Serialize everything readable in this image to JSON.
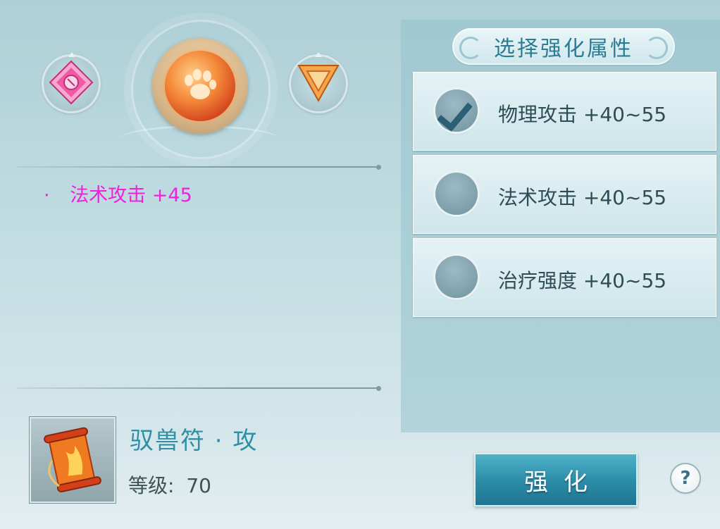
{
  "gems": {
    "left": {
      "icon": "pink-diamond-gem-icon",
      "color": "#e84a9c"
    },
    "center": {
      "icon": "orange-beast-claw-orb-icon",
      "color": "#f07a2e"
    },
    "right": {
      "icon": "orange-triangle-gem-icon",
      "color": "#f28a2a"
    }
  },
  "current_attribute": {
    "bullet": "·",
    "label": "法术攻击 +45",
    "color": "#ee22dd"
  },
  "item": {
    "icon": "fire-scroll-icon",
    "name": "驭兽符 · 攻",
    "level_label": "等级:",
    "level_value": "70"
  },
  "panel": {
    "title": "选择强化属性",
    "options": [
      {
        "label": "物理攻击 +40~55",
        "selected": true
      },
      {
        "label": "法术攻击 +40~55",
        "selected": false
      },
      {
        "label": "治疗强度 +40~55",
        "selected": false
      }
    ]
  },
  "buttons": {
    "enhance_label": "强化",
    "help_label": "?"
  }
}
